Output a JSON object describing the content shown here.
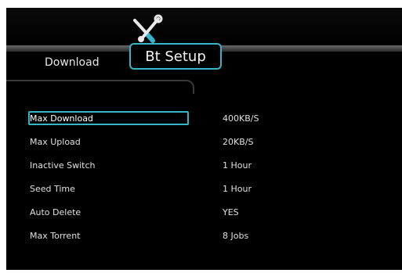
{
  "header": {
    "icon": "tools-icon",
    "tabs": [
      {
        "label": "Download",
        "active": false
      },
      {
        "label": "Bt Setup",
        "active": true
      }
    ],
    "accent_color": "#35b6c8"
  },
  "settings": [
    {
      "label": "Max Download",
      "value": "400KB/S",
      "selected": true
    },
    {
      "label": "Max Upload",
      "value": "20KB/S"
    },
    {
      "label": "Inactive Switch",
      "value": "1 Hour"
    },
    {
      "label": "Seed Time",
      "value": "1 Hour"
    },
    {
      "label": "Auto Delete",
      "value": "YES"
    },
    {
      "label": "Max Torrent",
      "value": "8 Jobs"
    }
  ]
}
